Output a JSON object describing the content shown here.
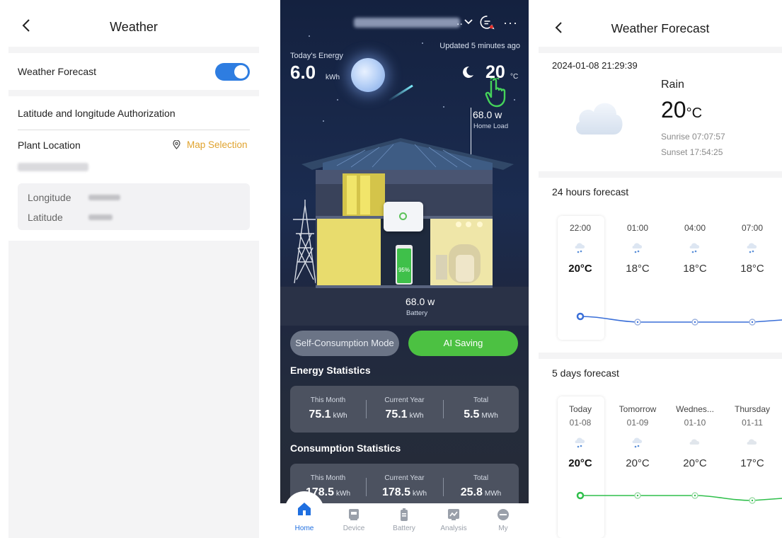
{
  "panel1": {
    "title": "Weather",
    "weather_forecast_label": "Weather Forecast",
    "weather_forecast_enabled": true,
    "lat_long_auth_label": "Latitude and longitude Authorization",
    "plant_location_label": "Plant Location",
    "map_selection_label": "Map Selection",
    "longitude_label": "Longitude",
    "latitude_label": "Latitude",
    "accent_color": "#2e7de1",
    "link_color": "#e0a32e"
  },
  "panel2": {
    "updated_text": "Updated 5 minutes ago",
    "todays_energy_label": "Today's Energy",
    "todays_energy_value": "6.0",
    "todays_energy_unit": "kWh",
    "temp_value": "20",
    "temp_unit": "°C",
    "home_load_value": "68.0 w",
    "home_load_label": "Home Load",
    "battery_percent_text": "95%",
    "battery_level": 0.95,
    "battery_power_value": "68.0 w",
    "battery_label": "Battery",
    "self_consumption_mode": "Self-Consumption Mode",
    "ai_saving": "AI Saving",
    "energy_statistics_title": "Energy Statistics",
    "energy_stats": [
      {
        "label": "This Month",
        "value": "75.1",
        "unit": "kWh"
      },
      {
        "label": "Current Year",
        "value": "75.1",
        "unit": "kWh"
      },
      {
        "label": "Total",
        "value": "5.5",
        "unit": "MWh"
      }
    ],
    "consumption_statistics_title": "Consumption Statistics",
    "consumption_stats": [
      {
        "label": "This Month",
        "value": "178.5",
        "unit": "kWh"
      },
      {
        "label": "Current Year",
        "value": "178.5",
        "unit": "kWh"
      },
      {
        "label": "Total",
        "value": "25.8",
        "unit": "MWh"
      }
    ],
    "tabs": [
      {
        "label": "Home",
        "icon": "home-icon",
        "active": true
      },
      {
        "label": "Device",
        "icon": "device-icon",
        "active": false
      },
      {
        "label": "Battery",
        "icon": "battery-icon",
        "active": false
      },
      {
        "label": "Analysis",
        "icon": "analysis-icon",
        "active": false
      },
      {
        "label": "My",
        "icon": "user-icon",
        "active": false
      }
    ],
    "accent_green": "#4cc142",
    "tab_active_color": "#1f6fe0"
  },
  "panel3": {
    "title": "Weather Forecast",
    "datetime": "2024-01-08 21:29:39",
    "condition": "Rain",
    "temp_value": "20",
    "temp_unit": "°C",
    "sunrise": "Sunrise 07:07:57",
    "sunset": "Sunset 17:54:25",
    "hours_title": "24 hours forecast",
    "hours": [
      {
        "time": "22:00",
        "temp": "20°C",
        "icon": "rain-icon"
      },
      {
        "time": "01:00",
        "temp": "18°C",
        "icon": "rain-icon"
      },
      {
        "time": "04:00",
        "temp": "18°C",
        "icon": "rain-icon"
      },
      {
        "time": "07:00",
        "temp": "18°C",
        "icon": "rain-icon"
      }
    ],
    "days_title": "5 days forecast",
    "days": [
      {
        "day": "Today",
        "date": "01-08",
        "temp": "20°C",
        "icon": "rain-icon"
      },
      {
        "day": "Tomorrow",
        "date": "01-09",
        "temp": "20°C",
        "icon": "rain-icon"
      },
      {
        "day": "Wednes...",
        "date": "01-10",
        "temp": "20°C",
        "icon": "cloud-icon"
      },
      {
        "day": "Thursday",
        "date": "01-11",
        "temp": "17°C",
        "icon": "cloud-icon"
      }
    ],
    "hours_curve_color": "#3a6fd8",
    "days_curve_color": "#2fbf4b"
  }
}
